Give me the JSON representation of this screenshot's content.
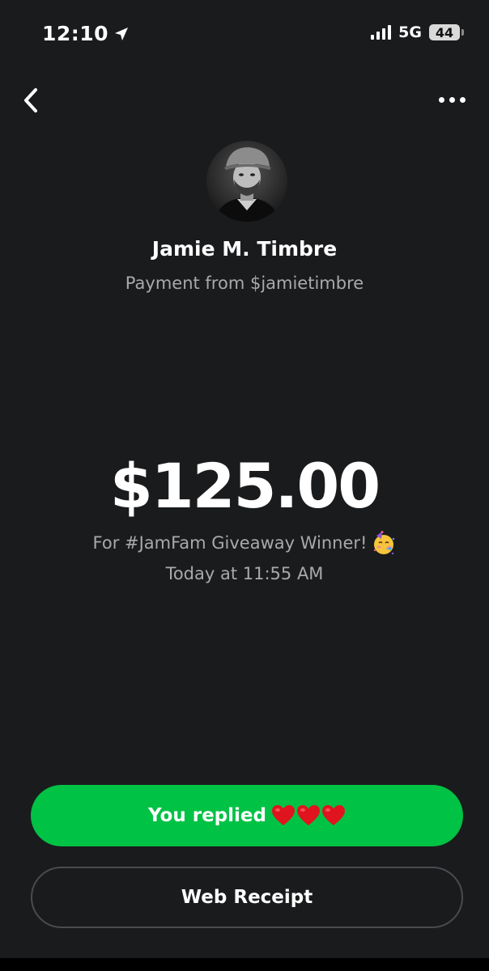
{
  "status_bar": {
    "time": "12:10",
    "network": "5G",
    "battery": "44"
  },
  "nav": {
    "back_icon": "chevron-left-icon",
    "more_icon": "ellipsis-icon"
  },
  "sender": {
    "name": "Jamie M. Timbre",
    "subtitle": "Payment from $jamietimbre"
  },
  "payment": {
    "amount": "$125.00",
    "note": "For #JamFam Giveaway Winner!",
    "note_emoji": "partying-face-icon",
    "timestamp": "Today at 11:55 AM"
  },
  "actions": {
    "reply_label": "You replied",
    "reply_hearts": [
      "heart-icon",
      "heart-icon",
      "heart-icon"
    ],
    "receipt_label": "Web Receipt"
  },
  "colors": {
    "background": "#1a1b1d",
    "accent_green": "#00c244",
    "muted_text": "#a9a9ab",
    "heart_red": "#e0141e"
  }
}
